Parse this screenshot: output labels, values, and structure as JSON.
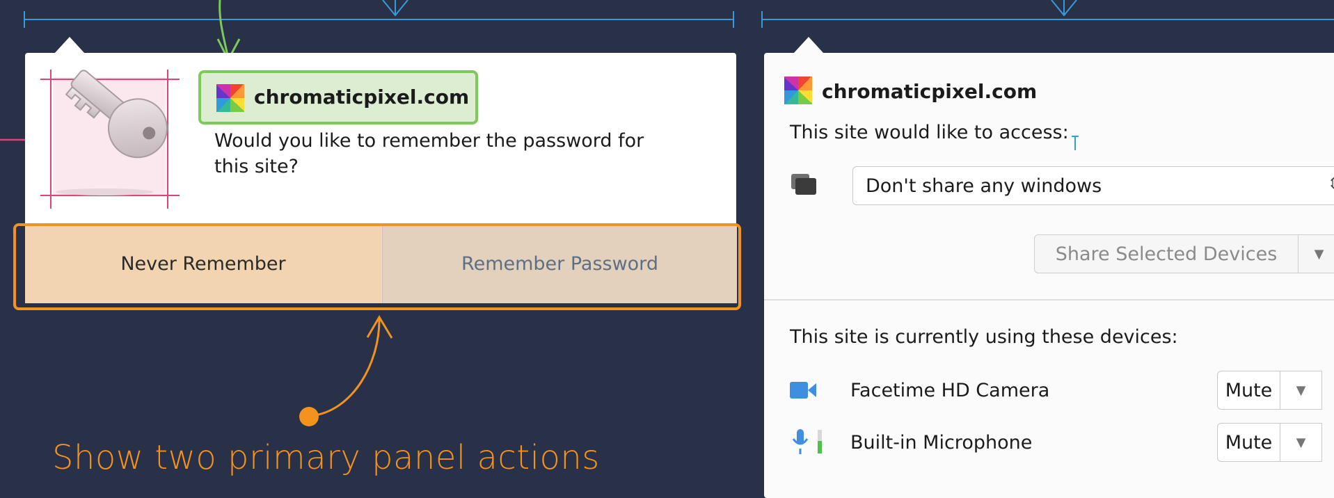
{
  "colors": {
    "background": "#283148",
    "measure_blue": "#3a9ad9",
    "annotation_green": "#7dca5c",
    "annotation_orange": "#f4921e",
    "annotation_pink": "#e0417a"
  },
  "password_panel": {
    "site": "chromaticpixel.com",
    "question": "Would you like to remember the password for this site?",
    "never_label": "Never Remember",
    "remember_label": "Remember Password",
    "icon": "key-icon"
  },
  "annotation": {
    "caption": "Show two primary panel actions"
  },
  "sharing_panel": {
    "site": "chromaticpixel.com",
    "access_prompt": "This site would like to access:",
    "window_select_value": "Don't share any windows",
    "share_button_label": "Share Selected Devices",
    "using_devices_label": "This site is currently using these devices:",
    "devices": [
      {
        "name": "Facetime HD Camera",
        "action": "Mute",
        "icon": "camera-icon"
      },
      {
        "name": "Built-in Microphone",
        "action": "Mute",
        "icon": "microphone-icon"
      }
    ]
  }
}
